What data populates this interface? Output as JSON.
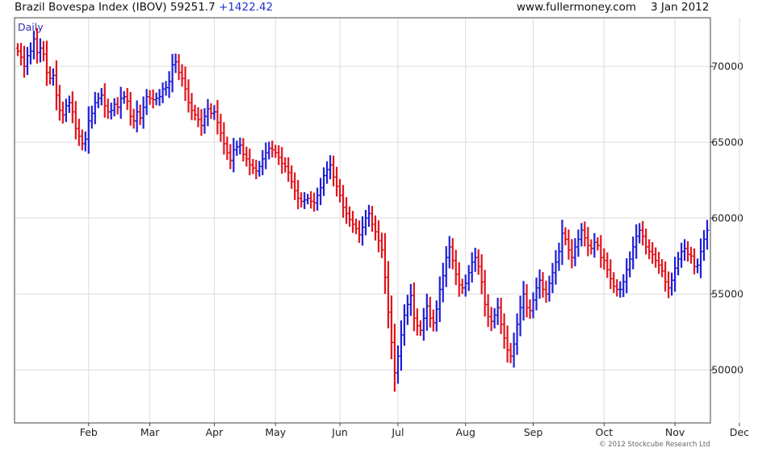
{
  "header": {
    "title": "Brazil Bovespa Index (IBOV) 59251.7",
    "change": "+1422.42",
    "site": "www.fullermoney.com",
    "date": "3 Jan 2012"
  },
  "copyright": "© 2012 Stockcube Research Ltd",
  "colors": {
    "up": "#1f1fd6",
    "down": "#e0141c",
    "grid": "#dcdcdc",
    "frame": "#444444",
    "period_label": "#2f2fb0"
  },
  "chart_data": {
    "type": "ohlc",
    "period_label": "Daily",
    "ylim": [
      46500,
      73200
    ],
    "y_ticks": [
      50000,
      55000,
      60000,
      65000,
      70000
    ],
    "y_tick_labels": [
      "50000",
      "55000",
      "60000",
      "65000",
      "70000"
    ],
    "x_tick_labels": [
      "Feb",
      "Mar",
      "Apr",
      "May",
      "Jun",
      "Jul",
      "Aug",
      "Sep",
      "Oct",
      "Nov",
      "Dec",
      "2012"
    ],
    "x_tick_positions": [
      22,
      41,
      61,
      80,
      100,
      118,
      139,
      160,
      182,
      204,
      224,
      245
    ],
    "grid": true,
    "series": [
      {
        "closes": [
          71000,
          70600,
          70000,
          70700,
          71000,
          71800,
          70900,
          71200,
          70800,
          69600,
          69200,
          69400,
          68100,
          67100,
          66800,
          67400,
          67600,
          67000,
          65900,
          65400,
          64900,
          65200,
          66400,
          66900,
          67600,
          67900,
          68100,
          67400,
          67000,
          67100,
          67500,
          67300,
          67900,
          68000,
          67700,
          66700,
          66400,
          67000,
          66600,
          67300,
          68000,
          67900,
          67800,
          67900,
          68000,
          68500,
          68600,
          69000,
          70100,
          70300,
          69600,
          69200,
          68500,
          67600,
          67100,
          66800,
          66500,
          66100,
          66700,
          67200,
          66900,
          67000,
          66300,
          65600,
          64900,
          64300,
          63800,
          64500,
          64700,
          64800,
          64200,
          63900,
          63500,
          63300,
          63100,
          63400,
          63900,
          64300,
          64600,
          64500,
          64300,
          64000,
          63600,
          63400,
          63000,
          62400,
          61800,
          61300,
          61100,
          61200,
          61300,
          61100,
          61000,
          61500,
          62000,
          62800,
          63200,
          63500,
          62700,
          62100,
          61500,
          60700,
          60300,
          59900,
          59600,
          59300,
          58900,
          59400,
          60000,
          60300,
          59600,
          59100,
          58500,
          57900,
          56100,
          53800,
          51800,
          49800,
          50900,
          52300,
          53600,
          54300,
          54900,
          53400,
          52900,
          52600,
          53400,
          54200,
          53400,
          53100,
          54000,
          55300,
          56200,
          57400,
          58100,
          57200,
          56300,
          55600,
          55400,
          55700,
          56400,
          57100,
          57400,
          56800,
          55800,
          54300,
          53500,
          53200,
          53600,
          54100,
          53000,
          52100,
          51300,
          50900,
          51700,
          53000,
          54100,
          55000,
          54100,
          53900,
          54600,
          55400,
          55900,
          55300,
          55000,
          55700,
          56400,
          57100,
          57800,
          59000,
          58600,
          57900,
          57400,
          58100,
          58600,
          59200,
          58700,
          58200,
          58000,
          58400,
          58200,
          57400,
          57200,
          56600,
          56000,
          55500,
          55300,
          55300,
          55800,
          56600,
          57300,
          58100,
          58800,
          59200,
          58800,
          58100,
          57800,
          57600,
          57200,
          56900,
          56500,
          55800,
          55400,
          55900,
          56700,
          57300,
          57800,
          58000,
          57600,
          57500,
          56800,
          56900,
          57800,
          58600,
          59200
        ]
      }
    ]
  }
}
